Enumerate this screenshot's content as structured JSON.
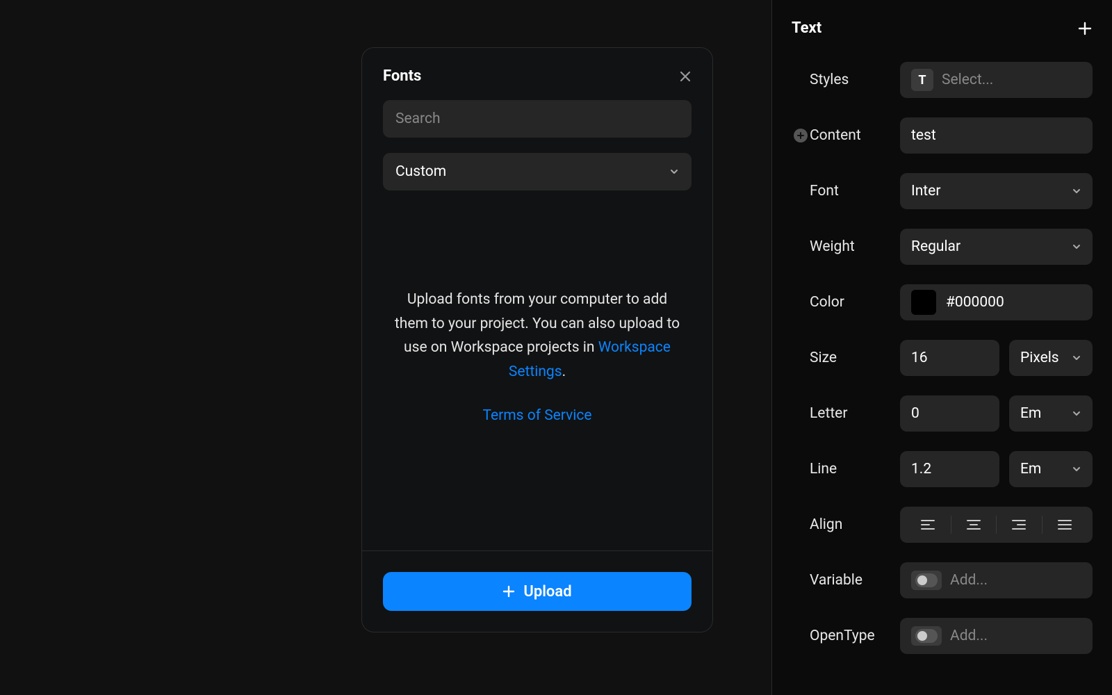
{
  "modal": {
    "title": "Fonts",
    "search_placeholder": "Search",
    "category_selected": "Custom",
    "message_part1": "Upload fonts from your computer to add them to your project. You can also upload to use on Workspace projects in ",
    "settings_link": "Workspace Settings",
    "message_suffix": ".",
    "tos_link": "Terms of Service",
    "upload_label": "Upload"
  },
  "inspector": {
    "section_title": "Text",
    "styles": {
      "label": "Styles",
      "placeholder": "Select..."
    },
    "content": {
      "label": "Content",
      "value": "test"
    },
    "font": {
      "label": "Font",
      "value": "Inter"
    },
    "weight": {
      "label": "Weight",
      "value": "Regular"
    },
    "color": {
      "label": "Color",
      "value": "#000000",
      "swatch": "#000000"
    },
    "size": {
      "label": "Size",
      "value": "16",
      "unit": "Pixels"
    },
    "letter": {
      "label": "Letter",
      "value": "0",
      "unit": "Em"
    },
    "line": {
      "label": "Line",
      "value": "1.2",
      "unit": "Em"
    },
    "align": {
      "label": "Align"
    },
    "variable": {
      "label": "Variable",
      "placeholder": "Add..."
    },
    "opentype": {
      "label": "OpenType",
      "placeholder": "Add..."
    }
  }
}
